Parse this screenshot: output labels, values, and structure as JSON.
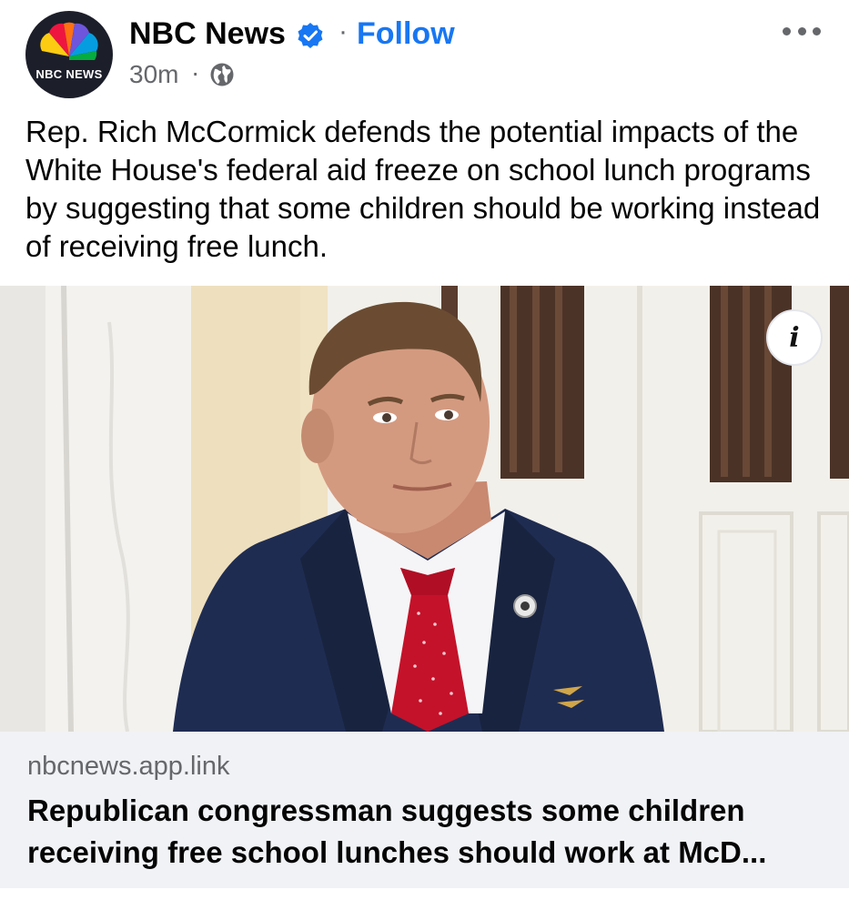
{
  "header": {
    "page_name": "NBC News",
    "follow_label": "Follow",
    "separator": "·",
    "timestamp": "30m",
    "avatar_text": "NBC NEWS",
    "verified_icon": "verified-badge-icon",
    "audience_icon": "globe-icon",
    "more_icon": "more-options-icon"
  },
  "post": {
    "caption": "Rep. Rich McCormick defends the potential impacts of the White House's federal aid freeze on school lunch programs by suggesting that some children should be working instead of receiving free lunch."
  },
  "media": {
    "info_icon": "info-icon",
    "info_label": "i"
  },
  "link_preview": {
    "domain": "nbcnews.app.link",
    "title": "Republican congressman suggests some children receiving free school lunches should work at McD..."
  },
  "colors": {
    "accent": "#1877f2",
    "secondary_text": "#65676b",
    "link_box_bg": "#f0f2f5"
  }
}
